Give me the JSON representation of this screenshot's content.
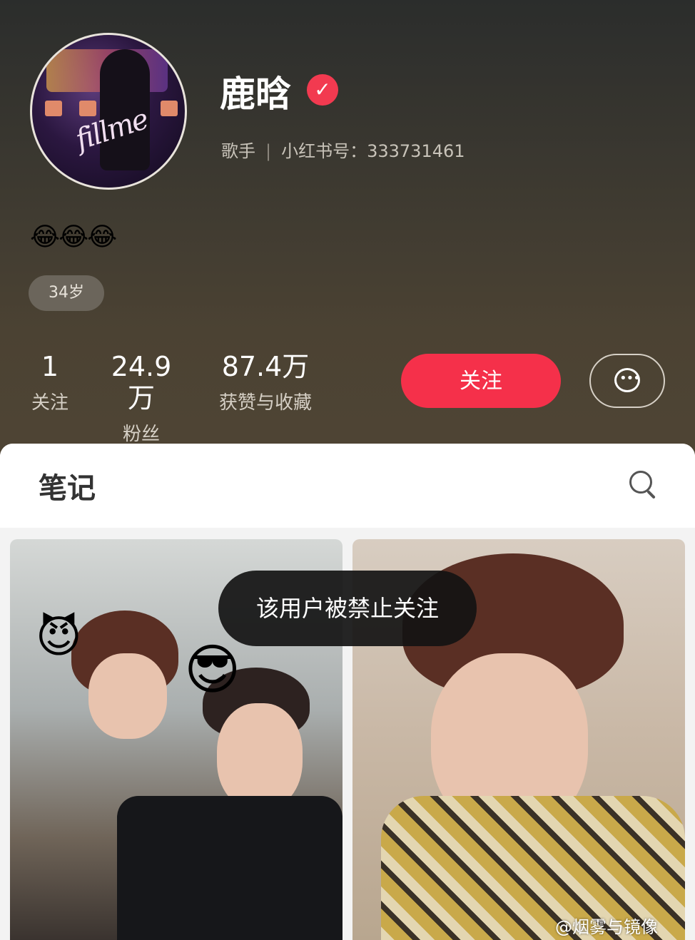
{
  "profile": {
    "name": "鹿晗",
    "role": "歌手",
    "id_label": "小红书号：333731461",
    "bio": "😂😂😂",
    "age_tag": "34岁",
    "verified_icon": "check-icon"
  },
  "stats": [
    {
      "value": "1",
      "label": "关注"
    },
    {
      "value": "24.9万",
      "label": "粉丝"
    },
    {
      "value": "87.4万",
      "label": "获赞与收藏"
    }
  ],
  "actions": {
    "follow_label": "关注",
    "message_icon": "chat-bubble-icon"
  },
  "tabs": {
    "notes_label": "笔记",
    "search_icon": "search-icon"
  },
  "feed": {
    "card1_emojis": [
      "😈",
      "😎"
    ]
  },
  "toast": "该用户被禁止关注",
  "watermark": "@烟雾与镜像",
  "colors": {
    "accent": "#f5304a",
    "verified": "#f23a50",
    "header_bg": "#3d362c"
  }
}
